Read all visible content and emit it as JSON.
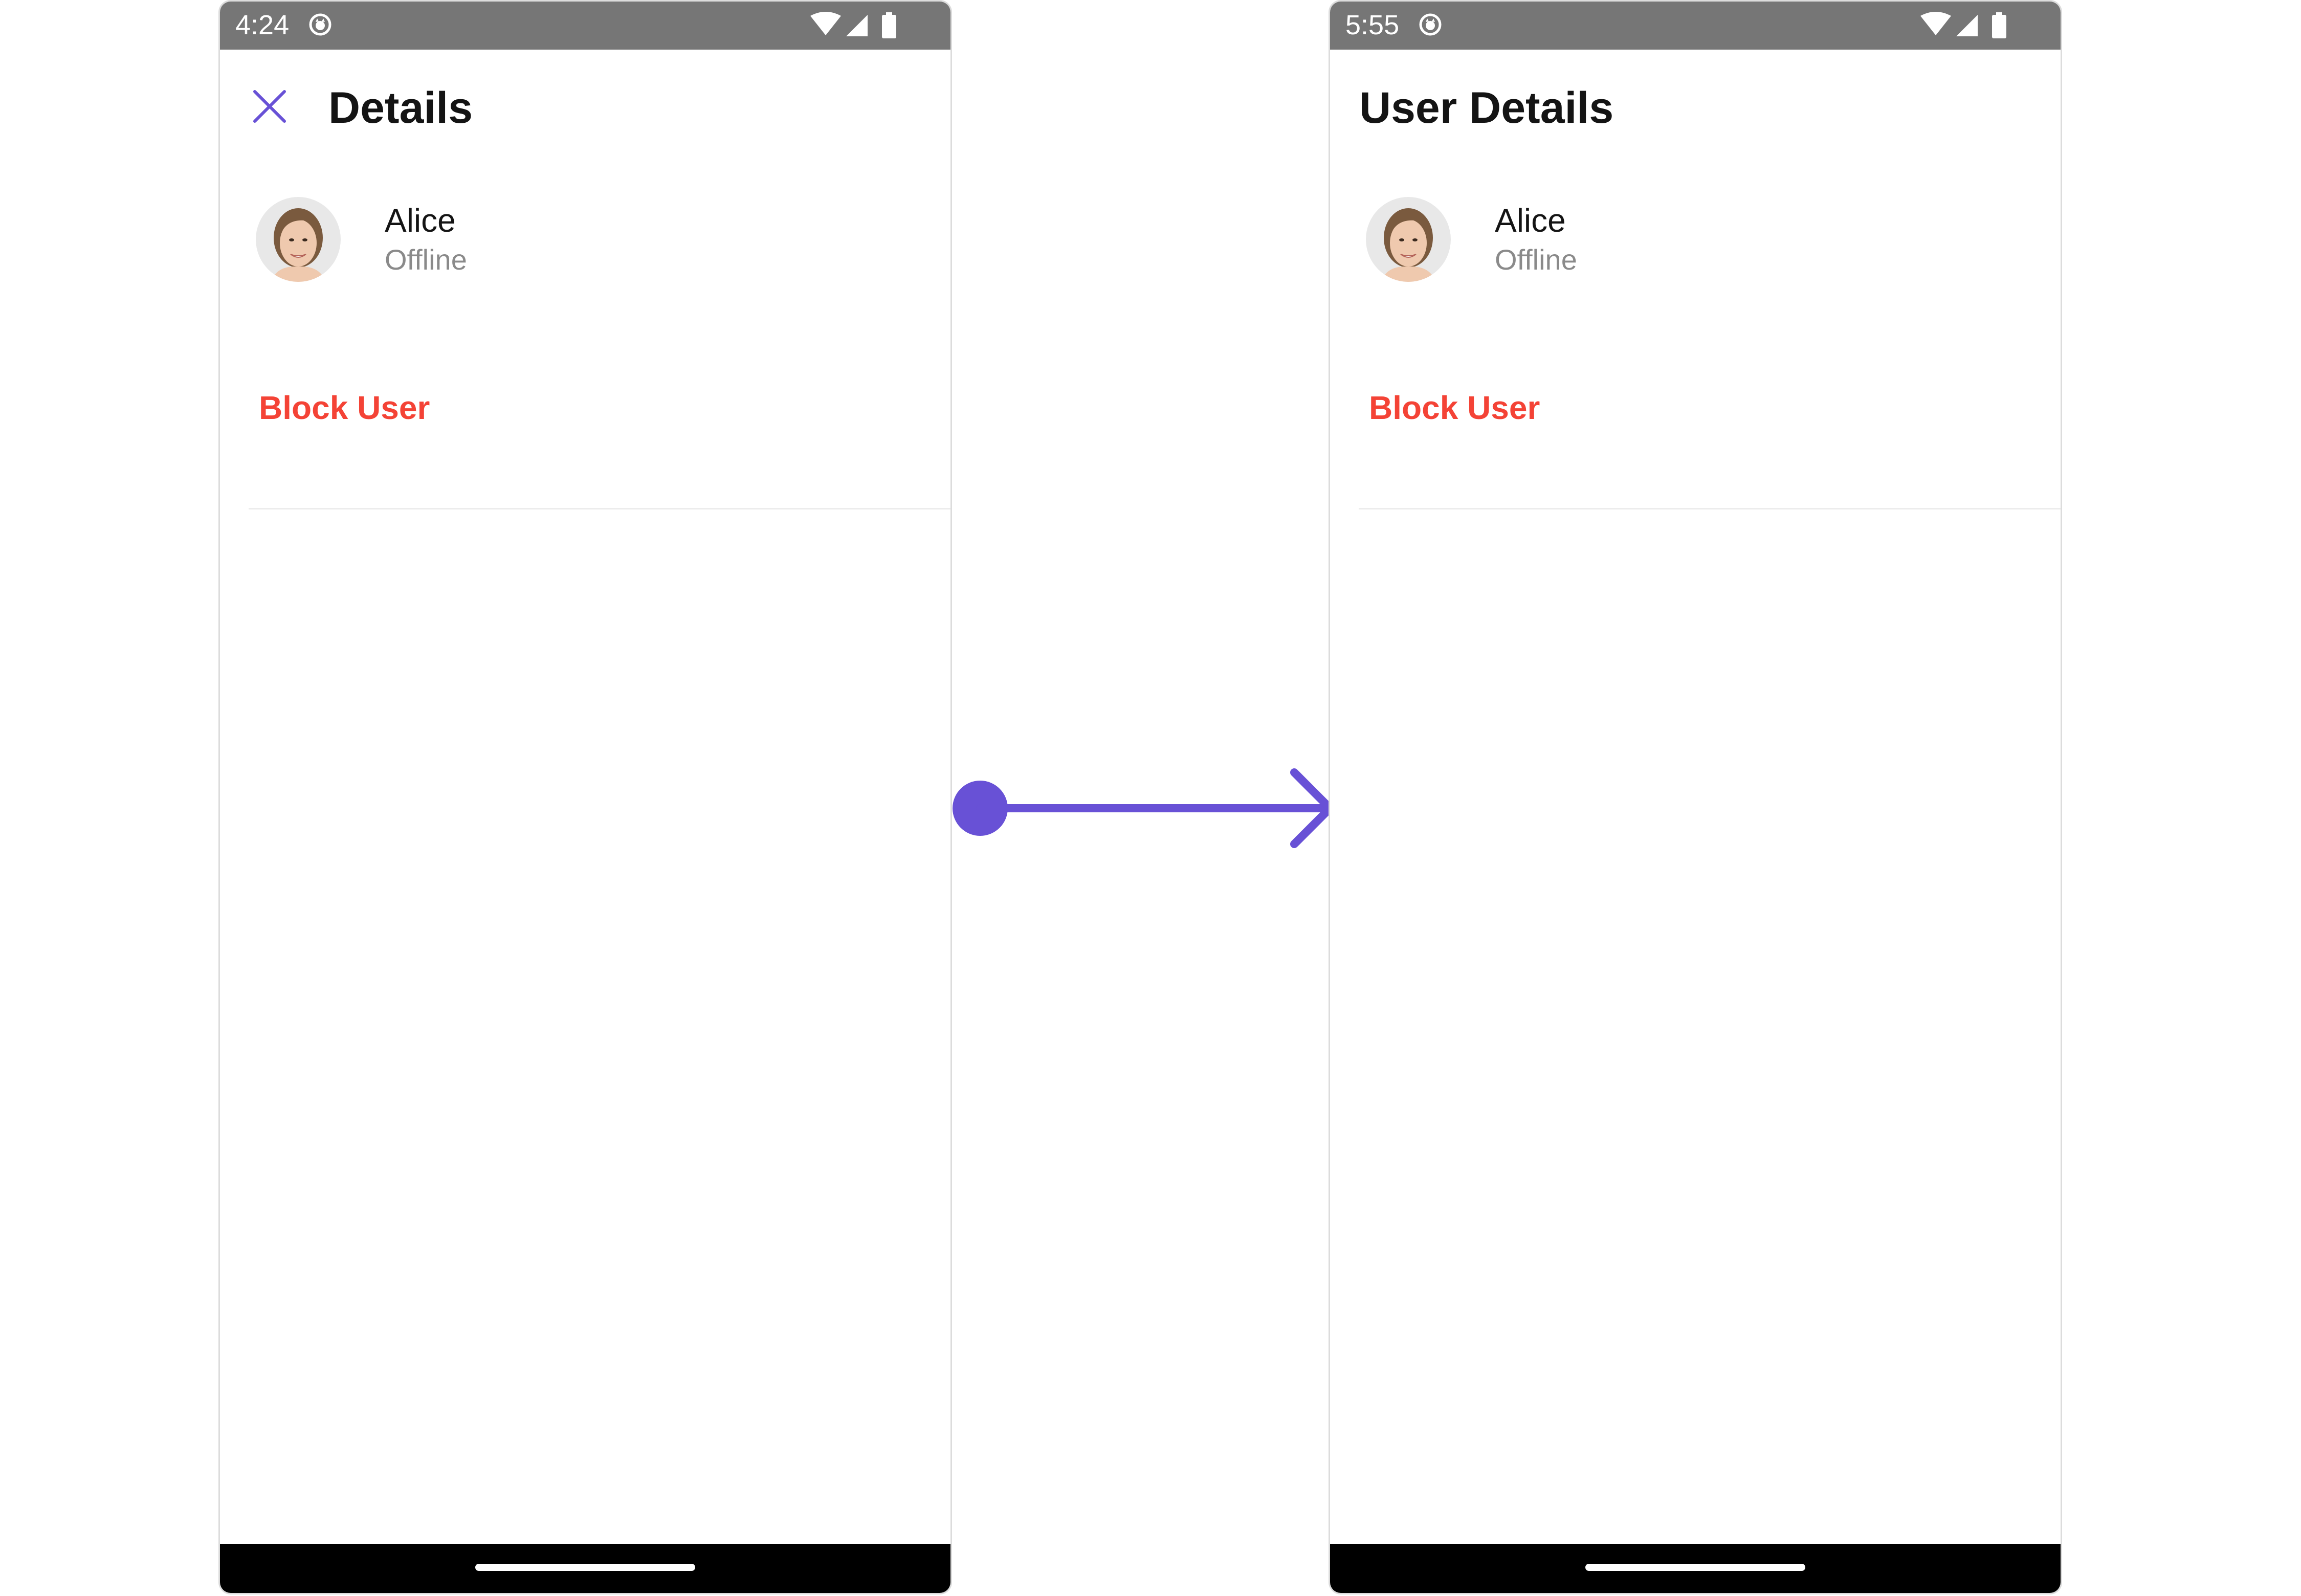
{
  "colors": {
    "status_bar": "#767676",
    "accent": "#6851D6",
    "danger": "#F44336",
    "text_primary": "#141414",
    "text_secondary": "#8A8A8A"
  },
  "left_screen": {
    "status_bar": {
      "time": "4:24",
      "icons": [
        "notification-icon",
        "wifi-icon",
        "signal-icon",
        "battery-icon"
      ]
    },
    "header": {
      "close_icon": "close-icon",
      "title": "Details"
    },
    "user": {
      "name": "Alice",
      "status": "Offline",
      "avatar": "avatar"
    },
    "actions": {
      "block_user": "Block User"
    }
  },
  "right_screen": {
    "status_bar": {
      "time": "5:55",
      "icons": [
        "notification-icon",
        "wifi-icon",
        "signal-icon",
        "battery-icon"
      ]
    },
    "header": {
      "title": "User Details"
    },
    "user": {
      "name": "Alice",
      "status": "Offline",
      "avatar": "avatar"
    },
    "actions": {
      "block_user": "Block User"
    }
  },
  "connector": {
    "icon": "arrow-right-icon"
  }
}
